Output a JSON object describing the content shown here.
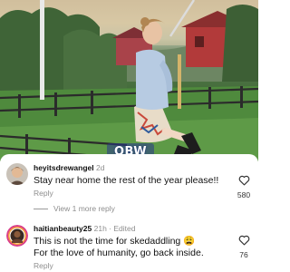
{
  "watermark": {
    "label": "OBW",
    "top_right": ""
  },
  "comments": [
    {
      "username": "heyitsdrewangel",
      "meta": "2d",
      "text": "Stay near home the rest of the year please!!",
      "reply_label": "Reply",
      "likes": "580"
    },
    {
      "username": "haitianbeauty25",
      "meta": "21h · Edited",
      "text_line1": "This is not the time for skedaddling 😩",
      "text_line2": "For the love of humanity, go back inside.",
      "reply_label": "Reply",
      "likes": "76"
    }
  ],
  "view_replies_label": "View 1 more reply",
  "icons": {
    "like": "heart-outline-icon",
    "emoji": "weary-face-emoji"
  },
  "colors": {
    "meta_gray": "#8e8e8e",
    "text": "#111111",
    "background": "#ffffff"
  }
}
